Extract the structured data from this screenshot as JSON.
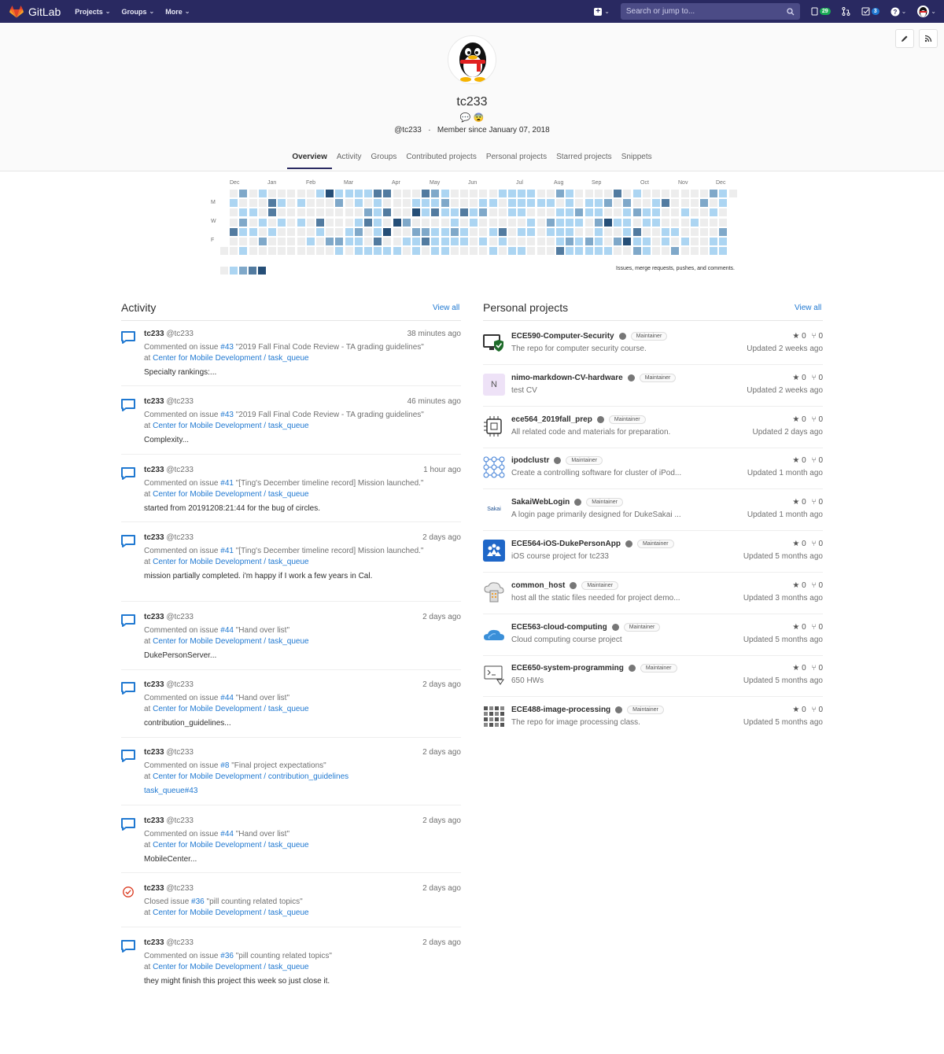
{
  "navbar": {
    "brand": "GitLab",
    "menus": [
      "Projects",
      "Groups",
      "More"
    ],
    "search_placeholder": "Search or jump to...",
    "issues_count": "29",
    "todos_count": "3"
  },
  "profile": {
    "username": "tc233",
    "handle": "@tc233",
    "member_since": "Member since January 07, 2018",
    "status_emojis": "💬 😨",
    "tabs": [
      "Overview",
      "Activity",
      "Groups",
      "Contributed projects",
      "Personal projects",
      "Starred projects",
      "Snippets"
    ]
  },
  "calendar": {
    "months": [
      "Dec",
      "Jan",
      "Feb",
      "Mar",
      "Apr",
      "May",
      "Jun",
      "Jul",
      "Aug",
      "Sep",
      "Oct",
      "Nov",
      "Dec"
    ],
    "day_labels": [
      "M",
      "W",
      "F"
    ],
    "legend_text": "Issues, merge requests, pushes, and comments.",
    "colors": [
      "#ededed",
      "#acd5f2",
      "#7fa8c9",
      "#527ba0",
      "#254e77"
    ]
  },
  "activity": {
    "title": "Activity",
    "view_all": "View all",
    "items": [
      {
        "user": "tc233",
        "handle": "@tc233",
        "time": "38 minutes ago",
        "action": "Commented on issue",
        "ref": "#43",
        "issue_title": "\"2019 Fall Final Code Review - TA grading guidelines\"",
        "at": "at",
        "namespace": "Center for Mobile Development / task_queue",
        "note": "Specialty rankings:...",
        "type": "comment"
      },
      {
        "user": "tc233",
        "handle": "@tc233",
        "time": "46 minutes ago",
        "action": "Commented on issue",
        "ref": "#43",
        "issue_title": "\"2019 Fall Final Code Review - TA grading guidelines\"",
        "at": "at",
        "namespace": "Center for Mobile Development / task_queue",
        "note": "Complexity...",
        "type": "comment"
      },
      {
        "user": "tc233",
        "handle": "@tc233",
        "time": "1 hour ago",
        "action": "Commented on issue",
        "ref": "#41",
        "issue_title": "\"[Ting's December timeline record] Mission launched.\"",
        "at": "at",
        "namespace": "Center for Mobile Development / task_queue",
        "note": "started from 20191208:21:44 for the bug of circles.",
        "type": "comment"
      },
      {
        "user": "tc233",
        "handle": "@tc233",
        "time": "2 days ago",
        "action": "Commented on issue",
        "ref": "#41",
        "issue_title": "\"[Ting's December timeline record] Mission launched.\"",
        "at": "at",
        "namespace": "Center for Mobile Development / task_queue",
        "note": "mission partially completed. i'm happy if I work a few years in Cal.",
        "type": "comment"
      },
      {
        "user": "tc233",
        "handle": "@tc233",
        "time": "2 days ago",
        "action": "Commented on issue",
        "ref": "#44",
        "issue_title": "\"Hand over list\"",
        "at": "at",
        "namespace": "Center for Mobile Development / task_queue",
        "note": "DukePersonServer...",
        "type": "comment"
      },
      {
        "user": "tc233",
        "handle": "@tc233",
        "time": "2 days ago",
        "action": "Commented on issue",
        "ref": "#44",
        "issue_title": "\"Hand over list\"",
        "at": "at",
        "namespace": "Center for Mobile Development / task_queue",
        "note": "contribution_guidelines...",
        "type": "comment"
      },
      {
        "user": "tc233",
        "handle": "@tc233",
        "time": "2 days ago",
        "action": "Commented on issue",
        "ref": "#8",
        "issue_title": "\"Final project expectations\"",
        "at": "at",
        "namespace": "Center for Mobile Development / contribution_guidelines",
        "note": "task_queue#43",
        "type": "comment-link"
      },
      {
        "user": "tc233",
        "handle": "@tc233",
        "time": "2 days ago",
        "action": "Commented on issue",
        "ref": "#44",
        "issue_title": "\"Hand over list\"",
        "at": "at",
        "namespace": "Center for Mobile Development / task_queue",
        "note": "MobileCenter...",
        "type": "comment"
      },
      {
        "user": "tc233",
        "handle": "@tc233",
        "time": "2 days ago",
        "action": "Closed issue",
        "ref": "#36",
        "issue_title": "\"pill counting related topics\"",
        "at": "at",
        "namespace": "Center for Mobile Development / task_queue",
        "note": "",
        "type": "closed"
      },
      {
        "user": "tc233",
        "handle": "@tc233",
        "time": "2 days ago",
        "action": "Commented on issue",
        "ref": "#36",
        "issue_title": "\"pill counting related topics\"",
        "at": "at",
        "namespace": "Center for Mobile Development / task_queue",
        "note": "they might finish this project this week so just close it.",
        "type": "comment"
      }
    ]
  },
  "projects": {
    "title": "Personal projects",
    "view_all": "View all",
    "items": [
      {
        "name": "ECE590-Computer-Security",
        "role": "Maintainer",
        "desc": "The repo for computer security course.",
        "stars": "0",
        "forks": "0",
        "updated": "Updated 2 weeks ago",
        "icon": "shield-monitor-icon"
      },
      {
        "name": "nimo-markdown-CV-hardware",
        "role": "Maintainer",
        "desc": "test CV",
        "stars": "0",
        "forks": "0",
        "updated": "Updated 2 weeks ago",
        "icon": "letter-n",
        "letter": "N"
      },
      {
        "name": "ece564_2019fall_prep",
        "role": "Maintainer",
        "desc": "All related code and materials for preparation.",
        "stars": "0",
        "forks": "0",
        "updated": "Updated 2 days ago",
        "icon": "chip-icon"
      },
      {
        "name": "ipodclustr",
        "role": "Maintainer",
        "desc": "Create a controlling software for cluster of iPod...",
        "stars": "0",
        "forks": "0",
        "updated": "Updated 1 month ago",
        "icon": "network-icon"
      },
      {
        "name": "SakaiWebLogin",
        "role": "Maintainer",
        "desc": "A login page primarily designed for DukeSakai ...",
        "stars": "0",
        "forks": "0",
        "updated": "Updated 1 month ago",
        "icon": "sakai-logo",
        "logo_text": "Sakai"
      },
      {
        "name": "ECE564-iOS-DukePersonApp",
        "role": "Maintainer",
        "desc": "iOS course project for tc233",
        "stars": "0",
        "forks": "0",
        "updated": "Updated 5 months ago",
        "icon": "people-icon"
      },
      {
        "name": "common_host",
        "role": "Maintainer",
        "desc": "host all the static files needed for project demo...",
        "stars": "0",
        "forks": "0",
        "updated": "Updated 3 months ago",
        "icon": "cloud-server-icon"
      },
      {
        "name": "ECE563-cloud-computing",
        "role": "Maintainer",
        "desc": "Cloud computing course project",
        "stars": "0",
        "forks": "0",
        "updated": "Updated 5 months ago",
        "icon": "cloud-icon"
      },
      {
        "name": "ECE650-system-programming",
        "role": "Maintainer",
        "desc": "650 HWs",
        "stars": "0",
        "forks": "0",
        "updated": "Updated 5 months ago",
        "icon": "terminal-icon"
      },
      {
        "name": "ECE488-image-processing",
        "role": "Maintainer",
        "desc": "The repo for image processing class.",
        "stars": "0",
        "forks": "0",
        "updated": "Updated 5 months ago",
        "icon": "grid-icon"
      }
    ]
  }
}
